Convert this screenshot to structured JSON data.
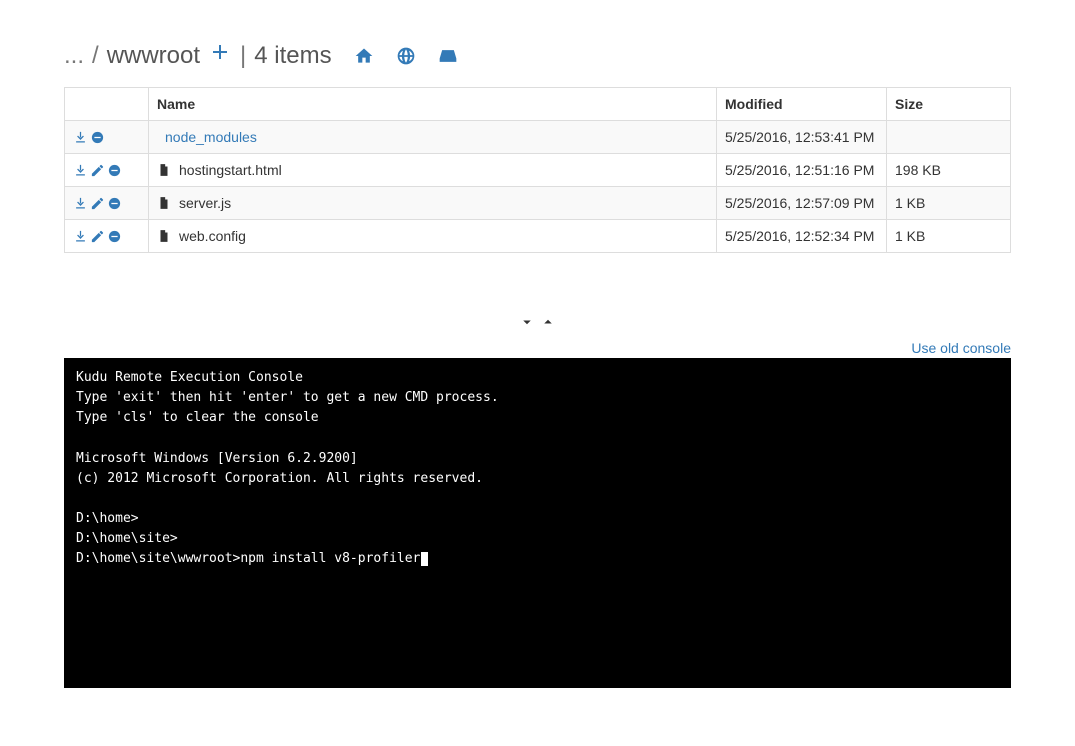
{
  "breadcrumb": {
    "ellipsis": "...",
    "sep": "/",
    "current": "wwwroot",
    "divider": "|",
    "count_text": "4 items"
  },
  "table": {
    "headers": {
      "actions": "",
      "name": "Name",
      "modified": "Modified",
      "size": "Size"
    },
    "rows": [
      {
        "type": "folder",
        "name": "node_modules",
        "modified": "5/25/2016, 12:53:41 PM",
        "size": "",
        "actions": [
          "download",
          "delete"
        ]
      },
      {
        "type": "file",
        "name": "hostingstart.html",
        "modified": "5/25/2016, 12:51:16 PM",
        "size": "198 KB",
        "actions": [
          "download",
          "edit",
          "delete"
        ]
      },
      {
        "type": "file",
        "name": "server.js",
        "modified": "5/25/2016, 12:57:09 PM",
        "size": "1 KB",
        "actions": [
          "download",
          "edit",
          "delete"
        ]
      },
      {
        "type": "file",
        "name": "web.config",
        "modified": "5/25/2016, 12:52:34 PM",
        "size": "1 KB",
        "actions": [
          "download",
          "edit",
          "delete"
        ]
      }
    ]
  },
  "old_console_link": "Use old console",
  "console_lines": [
    "Kudu Remote Execution Console",
    "Type 'exit' then hit 'enter' to get a new CMD process.",
    "Type 'cls' to clear the console",
    "",
    "Microsoft Windows [Version 6.2.9200]",
    "(c) 2012 Microsoft Corporation. All rights reserved.",
    "",
    "D:\\home>",
    "D:\\home\\site>"
  ],
  "console_prompt": "D:\\home\\site\\wwwroot>",
  "console_input": "npm install v8-profiler"
}
